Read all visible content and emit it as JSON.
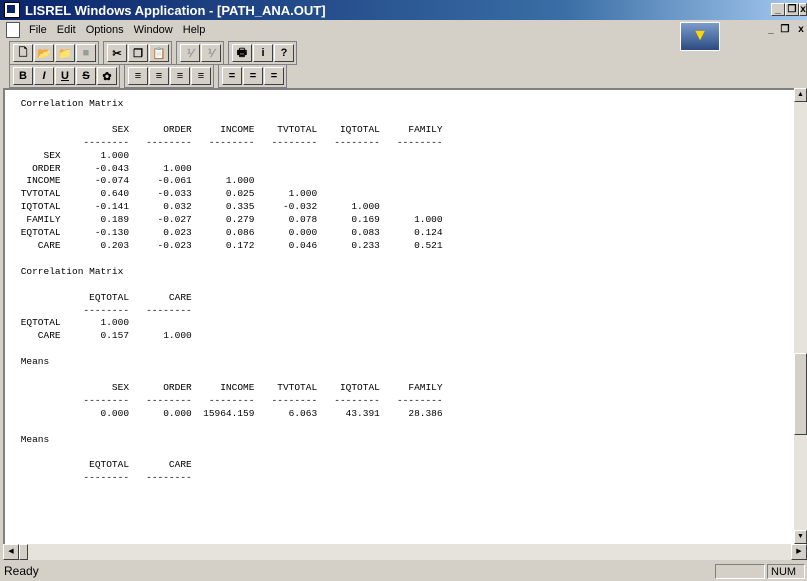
{
  "window": {
    "title": "LISREL Windows Application - [PATH_ANA.OUT]"
  },
  "menu": [
    "File",
    "Edit",
    "Options",
    "Window",
    "Help"
  ],
  "toolbar1": [
    {
      "icon": "new-icon",
      "glyph": "🗋"
    },
    {
      "icon": "open-icon",
      "glyph": "📂"
    },
    {
      "icon": "open-folder-icon",
      "glyph": "📁"
    },
    {
      "icon": "save-icon",
      "glyph": "■"
    },
    {
      "icon": "cut-icon",
      "glyph": "✂"
    },
    {
      "icon": "copy-icon",
      "glyph": "❐"
    },
    {
      "icon": "paste-icon",
      "glyph": "📋"
    },
    {
      "icon": "build-icon",
      "glyph": "⅟"
    },
    {
      "icon": "build-syntax-icon",
      "glyph": "⅟"
    },
    {
      "icon": "print-icon",
      "glyph": "🖶"
    },
    {
      "icon": "info-icon",
      "glyph": "i"
    },
    {
      "icon": "help-icon",
      "glyph": "?"
    }
  ],
  "toolbar2": [
    {
      "icon": "bold-icon",
      "glyph": "B"
    },
    {
      "icon": "italic-icon",
      "glyph": "I"
    },
    {
      "icon": "underline-icon",
      "glyph": "U"
    },
    {
      "icon": "strikethrough-icon",
      "glyph": "S"
    },
    {
      "icon": "color-icon",
      "glyph": "✿"
    },
    {
      "icon": "align-left-icon",
      "glyph": "≡"
    },
    {
      "icon": "align-center-icon",
      "glyph": "≡"
    },
    {
      "icon": "align-right-icon",
      "glyph": "≡"
    },
    {
      "icon": "justify-icon",
      "glyph": "≡"
    },
    {
      "icon": "line-spacing-1-icon",
      "glyph": "="
    },
    {
      "icon": "line-spacing-2-icon",
      "glyph": "="
    },
    {
      "icon": "line-spacing-3-icon",
      "glyph": "="
    }
  ],
  "output_lines": [
    " Correlation Matrix",
    "",
    "                 SEX      ORDER     INCOME    TVTOTAL    IQTOTAL     FAMILY",
    "            --------   --------   --------   --------   --------   --------",
    "     SEX       1.000",
    "   ORDER      -0.043      1.000",
    "  INCOME      -0.074     -0.061      1.000",
    " TVTOTAL       0.640     -0.033      0.025      1.000",
    " IQTOTAL      -0.141      0.032      0.335     -0.032      1.000",
    "  FAMILY       0.189     -0.027      0.279      0.078      0.169      1.000",
    " EQTOTAL      -0.130      0.023      0.086      0.000      0.083      0.124",
    "    CARE       0.203     -0.023      0.172      0.046      0.233      0.521",
    "",
    " Correlation Matrix",
    "",
    "             EQTOTAL       CARE",
    "            --------   --------",
    " EQTOTAL       1.000",
    "    CARE       0.157      1.000",
    "",
    " Means",
    "",
    "                 SEX      ORDER     INCOME    TVTOTAL    IQTOTAL     FAMILY",
    "            --------   --------   --------   --------   --------   --------",
    "               0.000      0.000  15964.159      6.063     43.391     28.386",
    "",
    " Means",
    "",
    "             EQTOTAL       CARE",
    "            --------   --------"
  ],
  "status": {
    "text": "Ready",
    "num": "NUM"
  }
}
